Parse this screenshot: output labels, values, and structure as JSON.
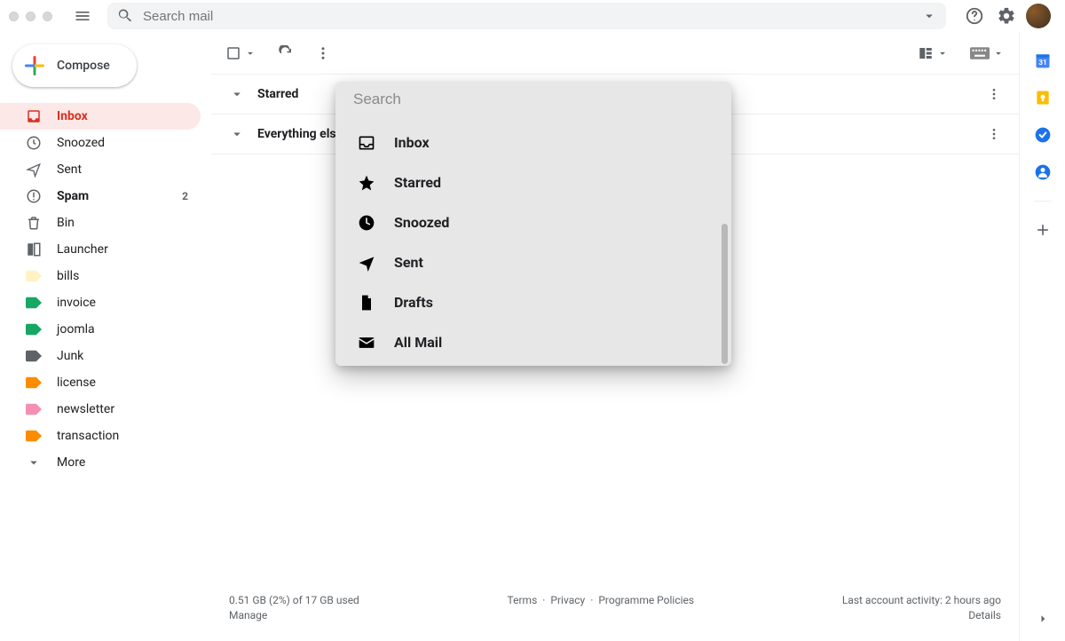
{
  "header": {
    "search_placeholder": "Search mail"
  },
  "compose_label": "Compose",
  "sidebar": {
    "items": [
      {
        "label": "Inbox",
        "icon": "inbox",
        "active": true
      },
      {
        "label": "Snoozed",
        "icon": "clock"
      },
      {
        "label": "Sent",
        "icon": "plane"
      },
      {
        "label": "Spam",
        "icon": "alert",
        "bold": true,
        "count": "2"
      },
      {
        "label": "Bin",
        "icon": "trash"
      },
      {
        "label": "Launcher",
        "icon": "launcher"
      },
      {
        "label": "bills",
        "icon": "tag",
        "color": "#fff3c4"
      },
      {
        "label": "invoice",
        "icon": "tag",
        "color": "#16a765"
      },
      {
        "label": "joomla",
        "icon": "tag",
        "color": "#16a765"
      },
      {
        "label": "Junk",
        "icon": "tag",
        "color": "#5f6368"
      },
      {
        "label": "license",
        "icon": "tag",
        "color": "#fb8c00"
      },
      {
        "label": "newsletter",
        "icon": "tag",
        "color": "#f48fb1"
      },
      {
        "label": "transaction",
        "icon": "tag",
        "color": "#fb8c00"
      },
      {
        "label": "More",
        "icon": "chev"
      }
    ]
  },
  "sections": {
    "starred": "Starred",
    "everything": "Everything else"
  },
  "dropdown": {
    "search_placeholder": "Search",
    "items": [
      {
        "label": "Inbox",
        "icon": "inbox"
      },
      {
        "label": "Starred",
        "icon": "star"
      },
      {
        "label": "Snoozed",
        "icon": "clock"
      },
      {
        "label": "Sent",
        "icon": "plane"
      },
      {
        "label": "Drafts",
        "icon": "file"
      },
      {
        "label": "All Mail",
        "icon": "mail"
      }
    ]
  },
  "footer": {
    "storage_line": "0.51 GB (2%) of 17 GB used",
    "manage": "Manage",
    "terms": "Terms",
    "privacy": "Privacy",
    "policies": "Programme Policies",
    "activity": "Last account activity: 2 hours ago",
    "details": "Details"
  }
}
